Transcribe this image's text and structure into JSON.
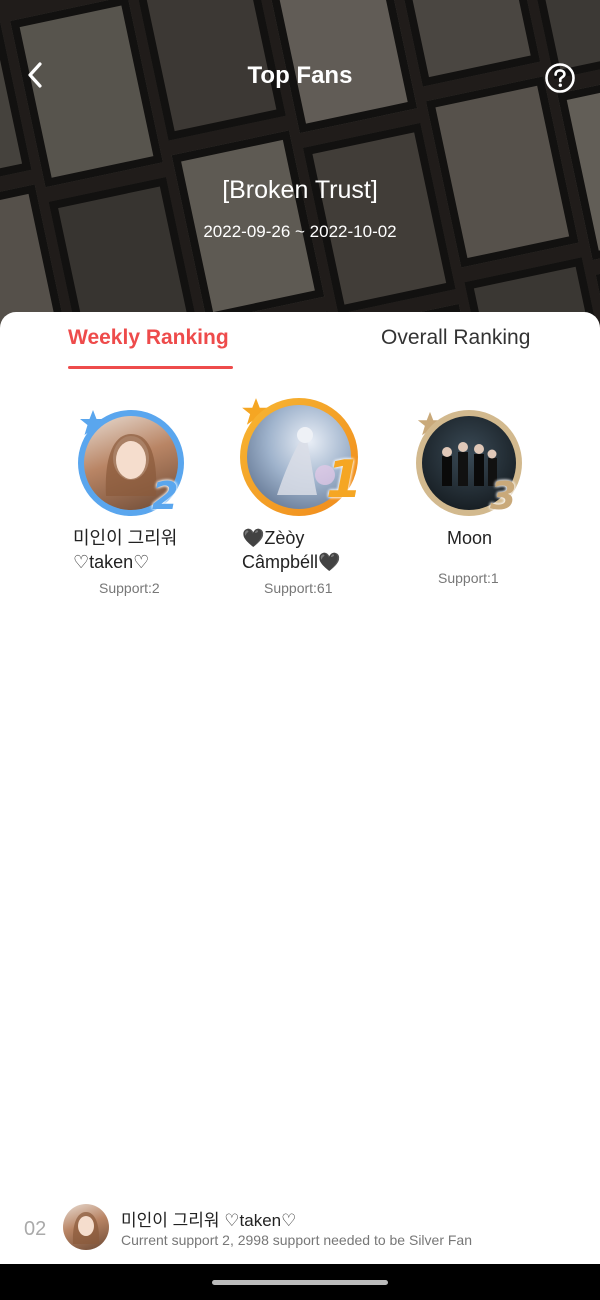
{
  "header": {
    "title": "Top Fans",
    "book_title": "[Broken Trust]",
    "date_range": "2022-09-26 ~ 2022-10-02",
    "back_icon": "chevron-left-icon",
    "help_icon": "question-circle-icon"
  },
  "tabs": [
    {
      "label": "Weekly Ranking",
      "active": true
    },
    {
      "label": "Overall Ranking",
      "active": false
    }
  ],
  "podium": [
    {
      "rank": "2",
      "name": "미인이 그리워 ♡taken♡",
      "support": "Support:2",
      "ring_color": "#5aa6ee"
    },
    {
      "rank": "1",
      "name": "🖤Zèòy Câmpbéll🖤",
      "support": "Support:61",
      "ring_color": "#f5a623"
    },
    {
      "rank": "3",
      "name": "Moon",
      "support": "Support:1",
      "ring_color": "#c9a97a"
    }
  ],
  "my_entry": {
    "rank": "02",
    "name": "미인이 그리워 ♡taken♡",
    "description": "Current support 2, 2998 support needed to be Silver Fan"
  },
  "colors": {
    "accent": "#ee4b4b",
    "gold": "#f5a623",
    "silver_blue": "#5aa6ee",
    "bronze": "#c9a97a"
  }
}
